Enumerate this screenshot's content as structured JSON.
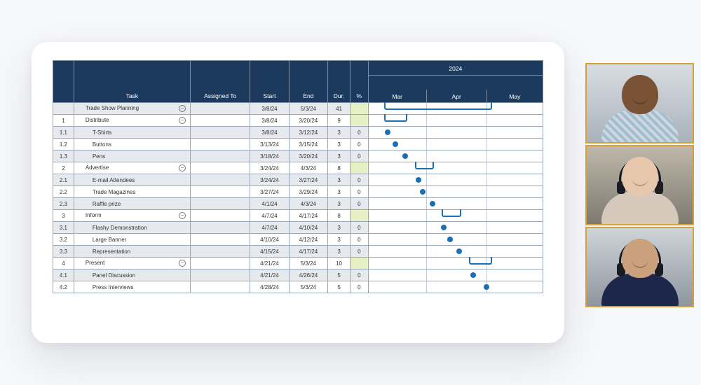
{
  "header": {
    "cols": {
      "task": "Task",
      "assigned": "Assigned To",
      "start": "Start",
      "end": "End",
      "dur": "Dur.",
      "pct": "%"
    },
    "year": "2024",
    "months": [
      "Mar",
      "Apr",
      "May"
    ]
  },
  "timeline": {
    "startDay": 0,
    "endDay": 90,
    "monthBounds": [
      0,
      30,
      61,
      90
    ]
  },
  "rows": [
    {
      "num": "",
      "task": "Trade Show Planning",
      "indent": 1,
      "collapse": true,
      "assigned": "",
      "start": "3/8/24",
      "end": "5/3/24",
      "dur": "41",
      "pct": "",
      "pctHL": true,
      "bar": {
        "type": "bracket",
        "from": 8,
        "to": 64
      }
    },
    {
      "num": "1",
      "task": "Distribute",
      "indent": 1,
      "collapse": true,
      "assigned": "",
      "start": "3/8/24",
      "end": "3/20/24",
      "dur": "9",
      "pct": "",
      "pctHL": true,
      "bar": {
        "type": "bracket",
        "from": 8,
        "to": 20
      }
    },
    {
      "num": "1.1",
      "task": "T-Shirts",
      "indent": 2,
      "collapse": false,
      "assigned": "",
      "start": "3/8/24",
      "end": "3/12/24",
      "dur": "3",
      "pct": "0",
      "pctHL": false,
      "bar": {
        "type": "dot",
        "at": 10
      }
    },
    {
      "num": "1.2",
      "task": "Buttons",
      "indent": 2,
      "collapse": false,
      "assigned": "",
      "start": "3/13/24",
      "end": "3/15/24",
      "dur": "3",
      "pct": "0",
      "pctHL": false,
      "bar": {
        "type": "dot",
        "at": 14
      }
    },
    {
      "num": "1.3",
      "task": "Pens",
      "indent": 2,
      "collapse": false,
      "assigned": "",
      "start": "3/18/24",
      "end": "3/20/24",
      "dur": "3",
      "pct": "0",
      "pctHL": false,
      "bar": {
        "type": "dot",
        "at": 19
      }
    },
    {
      "num": "2",
      "task": "Advertise",
      "indent": 1,
      "collapse": true,
      "assigned": "",
      "start": "3/24/24",
      "end": "4/3/24",
      "dur": "8",
      "pct": "",
      "pctHL": true,
      "bar": {
        "type": "bracket",
        "from": 24,
        "to": 34
      }
    },
    {
      "num": "2.1",
      "task": "E-mail Attendees",
      "indent": 2,
      "collapse": false,
      "assigned": "",
      "start": "3/24/24",
      "end": "3/27/24",
      "dur": "3",
      "pct": "0",
      "pctHL": false,
      "bar": {
        "type": "dot",
        "at": 26
      }
    },
    {
      "num": "2.2",
      "task": "Trade Magazines",
      "indent": 2,
      "collapse": false,
      "assigned": "",
      "start": "3/27/24",
      "end": "3/29/24",
      "dur": "3",
      "pct": "0",
      "pctHL": false,
      "bar": {
        "type": "dot",
        "at": 28
      }
    },
    {
      "num": "2.3",
      "task": "Raffle prize",
      "indent": 2,
      "collapse": false,
      "assigned": "",
      "start": "4/1/24",
      "end": "4/3/24",
      "dur": "3",
      "pct": "0",
      "pctHL": false,
      "bar": {
        "type": "dot",
        "at": 33
      }
    },
    {
      "num": "3",
      "task": "Inform",
      "indent": 1,
      "collapse": true,
      "assigned": "",
      "start": "4/7/24",
      "end": "4/17/24",
      "dur": "8",
      "pct": "",
      "pctHL": true,
      "bar": {
        "type": "bracket",
        "from": 38,
        "to": 48
      }
    },
    {
      "num": "3.1",
      "task": "Flashy Demonstration",
      "indent": 2,
      "collapse": false,
      "assigned": "",
      "start": "4/7/24",
      "end": "4/10/24",
      "dur": "3",
      "pct": "0",
      "pctHL": false,
      "bar": {
        "type": "dot",
        "at": 39
      }
    },
    {
      "num": "3.2",
      "task": "Large Banner",
      "indent": 2,
      "collapse": false,
      "assigned": "",
      "start": "4/10/24",
      "end": "4/12/24",
      "dur": "3",
      "pct": "0",
      "pctHL": false,
      "bar": {
        "type": "dot",
        "at": 42
      }
    },
    {
      "num": "3.3",
      "task": "Representation",
      "indent": 2,
      "collapse": false,
      "assigned": "",
      "start": "4/15/24",
      "end": "4/17/24",
      "dur": "3",
      "pct": "0",
      "pctHL": false,
      "bar": {
        "type": "dot",
        "at": 47
      }
    },
    {
      "num": "4",
      "task": "Present",
      "indent": 1,
      "collapse": true,
      "assigned": "",
      "start": "4/21/24",
      "end": "5/3/24",
      "dur": "10",
      "pct": "",
      "pctHL": true,
      "bar": {
        "type": "bracket",
        "from": 52,
        "to": 64
      }
    },
    {
      "num": "4.1",
      "task": "Panel Discussion",
      "indent": 2,
      "collapse": false,
      "assigned": "",
      "start": "4/21/24",
      "end": "4/26/24",
      "dur": "5",
      "pct": "0",
      "pctHL": false,
      "bar": {
        "type": "dot",
        "at": 54
      }
    },
    {
      "num": "4.2",
      "task": "Press Interviews",
      "indent": 2,
      "collapse": false,
      "assigned": "",
      "start": "4/28/24",
      "end": "5/3/24",
      "dur": "5",
      "pct": "0",
      "pctHL": false,
      "bar": {
        "type": "dot",
        "at": 61
      }
    }
  ],
  "videos": [
    {
      "name": "participant-1"
    },
    {
      "name": "participant-2"
    },
    {
      "name": "participant-3"
    }
  ]
}
